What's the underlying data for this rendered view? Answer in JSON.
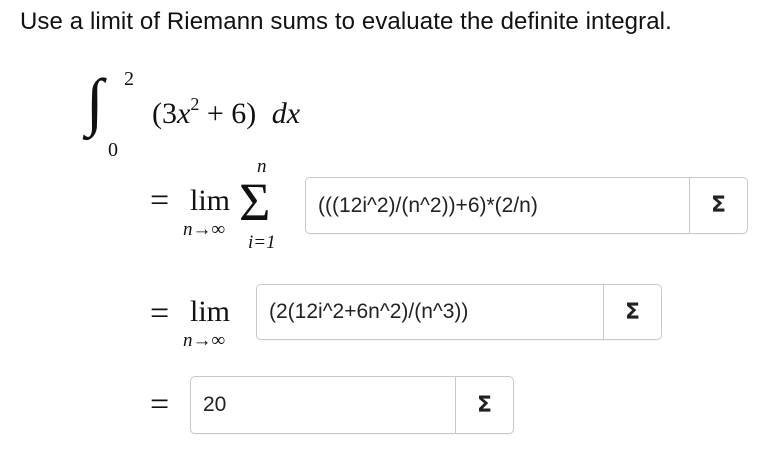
{
  "prompt": "Use a limit of Riemann sums to evaluate the definite integral.",
  "integral": {
    "sign": "∫",
    "upper": "2",
    "lower": "0",
    "open": "(3",
    "var": "x",
    "power": "2",
    "rest": " + 6)",
    "dx": "dx"
  },
  "step1": {
    "equals": "=",
    "lim": "lim",
    "lim_sub": "n→∞",
    "sigma": "Σ",
    "sigma_top": "n",
    "sigma_bottom": "i=1",
    "answer": "(((12i^2)/(n^2))+6)*(2/n)",
    "button_icon": "sigma-icon"
  },
  "step2": {
    "equals": "=",
    "lim": "lim",
    "lim_sub": "n→∞",
    "answer": "(2(12i^2+6n^2)/(n^3))",
    "button_icon": "sigma-icon"
  },
  "step3": {
    "equals": "=",
    "answer": "20",
    "button_icon": "sigma-icon"
  },
  "icon_glyph": "Σ"
}
